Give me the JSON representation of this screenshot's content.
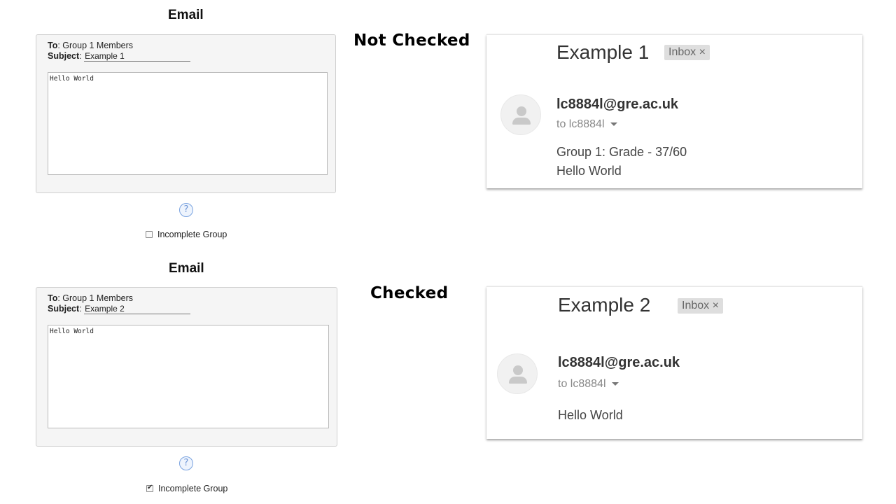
{
  "examples": [
    {
      "compose": {
        "title": "Email",
        "to_label": "To",
        "to_value": ": Group 1 Members",
        "subject_label": "Subject",
        "subject_colon": ":",
        "subject_value": "Example 1",
        "body": "Hello World",
        "help_icon": "?",
        "checkbox_label": "Incomplete Group",
        "checkbox_checked": false
      },
      "state_label": "Not Checked",
      "result": {
        "subject": "Example 1",
        "chip": "Inbox ×",
        "sender": "lc8884l@gre.ac.uk",
        "to": "to lc8884l",
        "body_lines": [
          "Group 1: Grade - 37/60",
          "Hello World"
        ]
      }
    },
    {
      "compose": {
        "title": "Email",
        "to_label": "To",
        "to_value": ": Group 1 Members",
        "subject_label": "Subject",
        "subject_colon": ":",
        "subject_value": "Example 2",
        "body": "Hello World",
        "help_icon": "?",
        "checkbox_label": "Incomplete Group",
        "checkbox_checked": true
      },
      "state_label": "Checked",
      "result": {
        "subject": "Example 2",
        "chip": "Inbox ×",
        "sender": "lc8884l@gre.ac.uk",
        "to": "to lc8884l",
        "body_lines": [
          "Hello World"
        ]
      }
    }
  ],
  "icons": {
    "help": "question-mark-circle-icon",
    "avatar": "default-avatar-icon",
    "caret": "caret-down-icon",
    "checkbox": "checkbox-icon"
  },
  "colors": {
    "help_icon": "#6d95d6",
    "panel_bg": "#f5f5f5",
    "chip_bg": "#dedede"
  }
}
